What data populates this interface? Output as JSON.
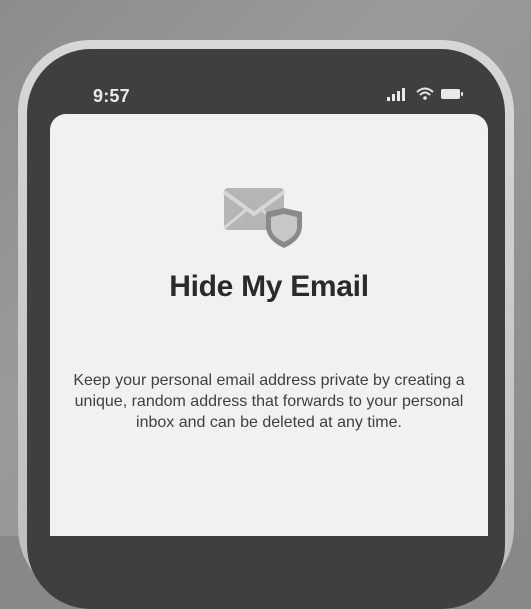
{
  "status_bar": {
    "time": "9:57",
    "icons": [
      "signal-bars-icon",
      "wifi-icon",
      "battery-icon"
    ]
  },
  "screen": {
    "illustration": "envelope-with-shield-icon",
    "title": "Hide My Email",
    "description": "Keep your personal email address private by creating a unique, random address that forwards to your personal inbox and can be deleted at any time."
  },
  "colors": {
    "screen_background": "#f1f1f1",
    "title_text": "#2a2a2a",
    "body_text": "#3f3f3f",
    "status_text": "#e9e9e9"
  }
}
